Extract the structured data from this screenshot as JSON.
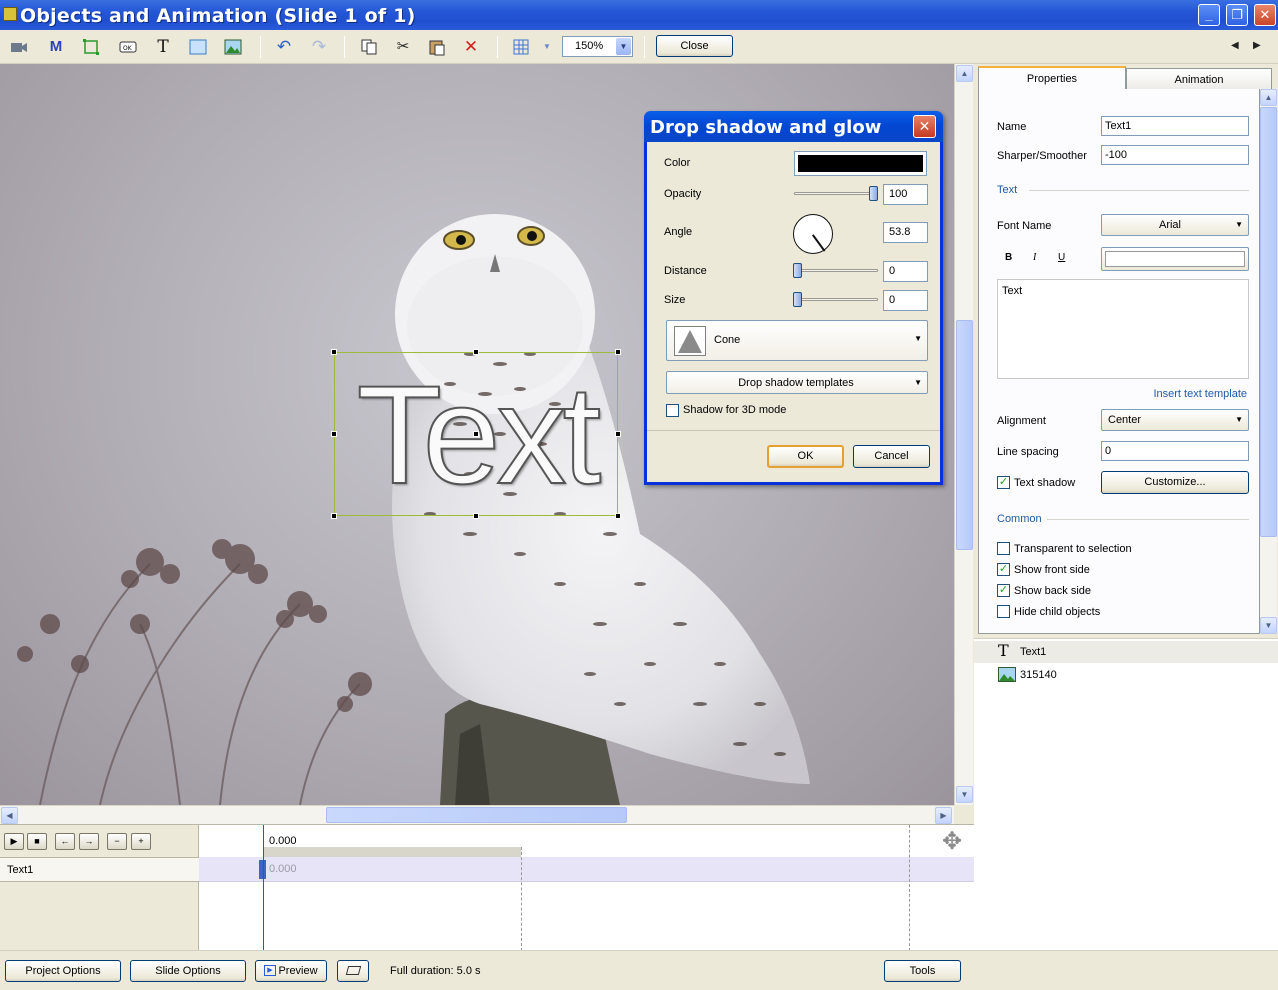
{
  "window": {
    "title": "Objects and Animation (Slide 1 of 1)",
    "minimize": "_",
    "maximize": "❐",
    "close": "✕"
  },
  "toolbar": {
    "zoom_value": "150%",
    "close_label": "Close",
    "icons": [
      "camera-icon",
      "mask-icon",
      "frame-icon",
      "button-icon",
      "text-icon",
      "rectangle-icon",
      "image-icon",
      "undo-icon",
      "redo-icon",
      "copy-icon",
      "cut-icon",
      "paste-icon",
      "delete-icon",
      "grid-icon",
      "grid-dropdown-icon"
    ]
  },
  "canvas": {
    "text_object": "Text"
  },
  "dialog": {
    "title": "Drop shadow and glow",
    "color_label": "Color",
    "color_value": "#000000",
    "opacity_label": "Opacity",
    "opacity_value": "100",
    "angle_label": "Angle",
    "angle_value": "53.8",
    "distance_label": "Distance",
    "distance_value": "0",
    "size_label": "Size",
    "size_value": "0",
    "shape_value": "Cone",
    "templates_label": "Drop shadow templates",
    "shadow3d_label": "Shadow for 3D mode",
    "shadow3d_checked": false,
    "ok_label": "OK",
    "cancel_label": "Cancel"
  },
  "tabs": {
    "properties": "Properties",
    "animation": "Animation"
  },
  "properties": {
    "name_label": "Name",
    "name_value": "Text1",
    "sharper_label": "Sharper/Smoother",
    "sharper_value": "-100",
    "text_section": "Text",
    "font_name_label": "Font Name",
    "font_name_value": "Arial",
    "bold_label": "B",
    "italic_label": "I",
    "underline_label": "U",
    "text_content": "Text",
    "insert_template_link": "Insert text template",
    "alignment_label": "Alignment",
    "alignment_value": "Center",
    "line_spacing_label": "Line spacing",
    "line_spacing_value": "0",
    "text_shadow_label": "Text shadow",
    "text_shadow_checked": true,
    "customize_label": "Customize...",
    "common_section": "Common",
    "transparent_label": "Transparent to selection",
    "transparent_checked": false,
    "front_label": "Show front side",
    "front_checked": true,
    "back_label": "Show back side",
    "back_checked": true,
    "hide_child_label": "Hide child objects",
    "hide_child_checked": false
  },
  "objects": [
    {
      "name": "Text1",
      "icon": "text-type-icon"
    },
    {
      "name": "315140",
      "icon": "image-type-icon"
    }
  ],
  "timeline": {
    "time_marker": "0.000",
    "row_name": "Text1",
    "row_time": "0.000"
  },
  "bottom": {
    "project_options": "Project Options",
    "slide_options": "Slide Options",
    "preview": "Preview",
    "full_duration": "Full duration: 5.0 s",
    "tools": "Tools"
  }
}
